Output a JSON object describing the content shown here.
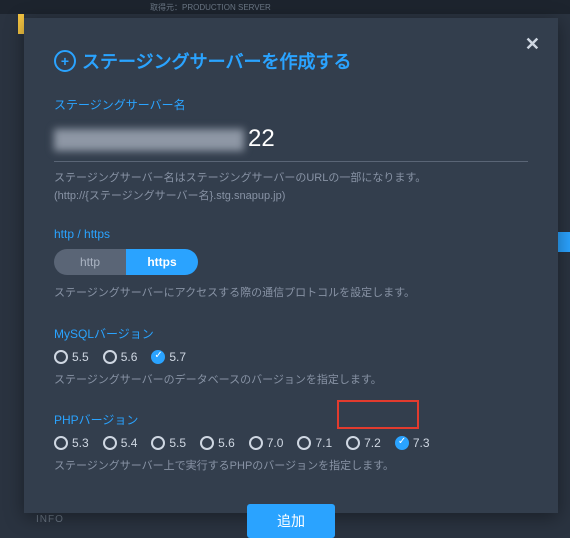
{
  "top_strip": "取得元：PRODUCTION SERVER",
  "bg_info": "INFO",
  "modal": {
    "title": "ステージングサーバーを作成する",
    "close": "✕"
  },
  "name": {
    "label": "ステージングサーバー名",
    "value_suffix": "22",
    "help1": "ステージングサーバー名はステージングサーバーのURLの一部になります。",
    "help2": "(http://{ステージングサーバー名}.stg.snapup.jp)"
  },
  "protocol": {
    "label": "http / https",
    "http": "http",
    "https": "https",
    "help": "ステージングサーバーにアクセスする際の通信プロトコルを設定します。"
  },
  "mysql": {
    "label": "MySQLバージョン",
    "options": [
      "5.5",
      "5.6",
      "5.7"
    ],
    "selected": "5.7",
    "help": "ステージングサーバーのデータベースのバージョンを指定します。"
  },
  "php": {
    "label": "PHPバージョン",
    "options": [
      "5.3",
      "5.4",
      "5.5",
      "5.6",
      "7.0",
      "7.1",
      "7.2",
      "7.3"
    ],
    "selected": "7.3",
    "help": "ステージングサーバー上で実行するPHPのバージョンを指定します。"
  },
  "submit": "追加"
}
